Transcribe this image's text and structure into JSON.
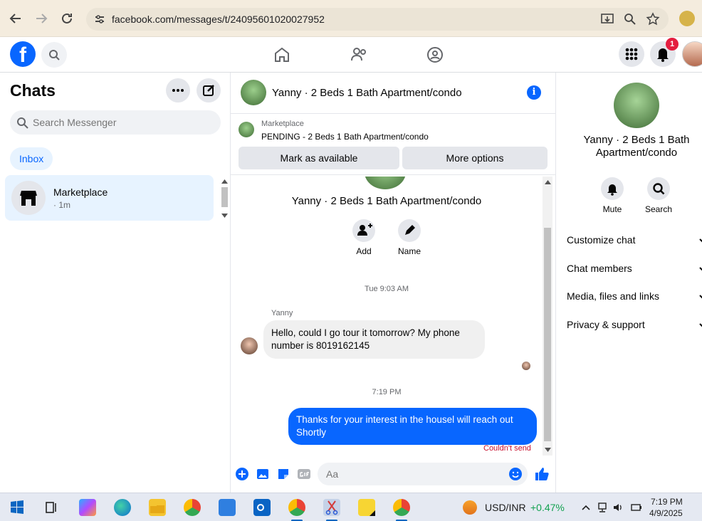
{
  "browser": {
    "url": "facebook.com/messages/t/24095601020027952"
  },
  "fb_nav": {
    "logo": "f",
    "notification_count": "1"
  },
  "sidebar": {
    "title": "Chats",
    "search_placeholder": "Search Messenger",
    "filter_label": "Inbox",
    "chats": [
      {
        "name": "Marketplace",
        "time": "· 1m"
      }
    ]
  },
  "conversation": {
    "title": "Yanny · 2 Beds 1 Bath Apartment/condo",
    "info_icon": "i",
    "marketplace": {
      "label": "Marketplace",
      "status": "PENDING - 2 Beds 1 Bath Apartment/condo",
      "mark_available_label": "Mark as available",
      "more_options_label": "More options"
    },
    "intro": {
      "title": "Yanny · 2 Beds 1 Bath Apartment/condo",
      "add_label": "Add",
      "name_label": "Name"
    },
    "messages": {
      "ts1": "Tue 9:03 AM",
      "sender": "Yanny",
      "incoming": "Hello, could I go tour it tomorrow? My phone number is 8019162145",
      "ts2": "7:19 PM",
      "outgoing": "Thanks for your interest in the housel will reach out Shortly",
      "error": "Couldn't send"
    },
    "composer_placeholder": "Aa"
  },
  "details": {
    "title": "Yanny · 2 Beds 1 Bath Apartment/condo",
    "mute_label": "Mute",
    "search_label": "Search",
    "sections": [
      "Customize chat",
      "Chat members",
      "Media, files and links",
      "Privacy & support"
    ]
  },
  "taskbar": {
    "ticker_symbol": "USD/INR",
    "ticker_change": "+0.47%",
    "time": "7:19 PM",
    "date": "4/9/2025"
  },
  "colors": {
    "brand": "#0866ff",
    "selected_bg": "#e7f3ff",
    "error": "#c8102e",
    "ticker_up": "#12a150"
  }
}
